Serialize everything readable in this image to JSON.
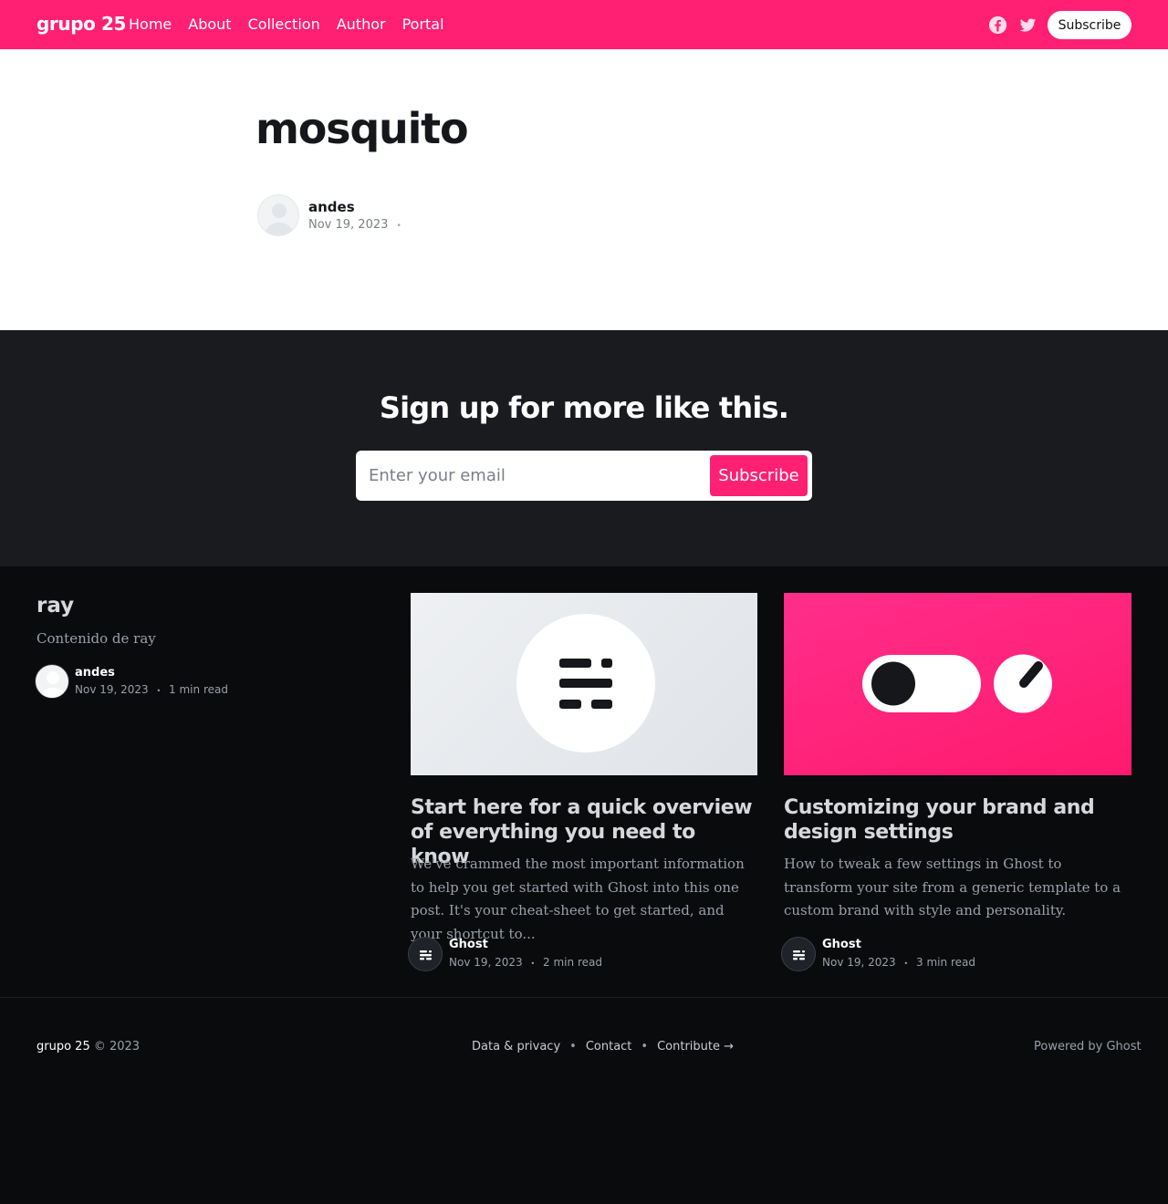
{
  "header": {
    "brand": "grupo 25",
    "nav": [
      "Home",
      "About",
      "Collection",
      "Author",
      "Portal"
    ],
    "subscribe_label": "Subscribe",
    "social_icons": [
      "facebook-icon",
      "twitter-icon"
    ],
    "accent_color": "#ff1f73"
  },
  "article": {
    "title": "mosquito",
    "author": "andes",
    "date": "Nov 19, 2023",
    "separator": "•"
  },
  "cta": {
    "title": "Sign up for more like this.",
    "email_placeholder": "Enter your email",
    "button_label": "Subscribe"
  },
  "feed": {
    "featured": {
      "title": "ray",
      "excerpt": "Contenido de ray",
      "author": "andes",
      "date": "Nov 19, 2023",
      "read_time": "1 min read"
    },
    "cards": [
      {
        "title": "Start here for a quick overview of everything you need to know",
        "excerpt": "We've crammed the most important information to help you get started with Ghost into this one post. It's your cheat-sheet to get started, and your shortcut to...",
        "author": "Ghost",
        "date": "Nov 19, 2023",
        "read_time": "2 min read"
      },
      {
        "title": "Customizing your brand and design settings",
        "excerpt": "How to tweak a few settings in Ghost to transform your site from a generic template to a custom brand with style and personality.",
        "author": "Ghost",
        "date": "Nov 19, 2023",
        "read_time": "3 min read"
      }
    ]
  },
  "footer": {
    "brand": "grupo 25",
    "copyright": "© 2023",
    "links": [
      "Data & privacy",
      "Contact",
      "Contribute →"
    ],
    "powered_by": "Powered by Ghost"
  }
}
